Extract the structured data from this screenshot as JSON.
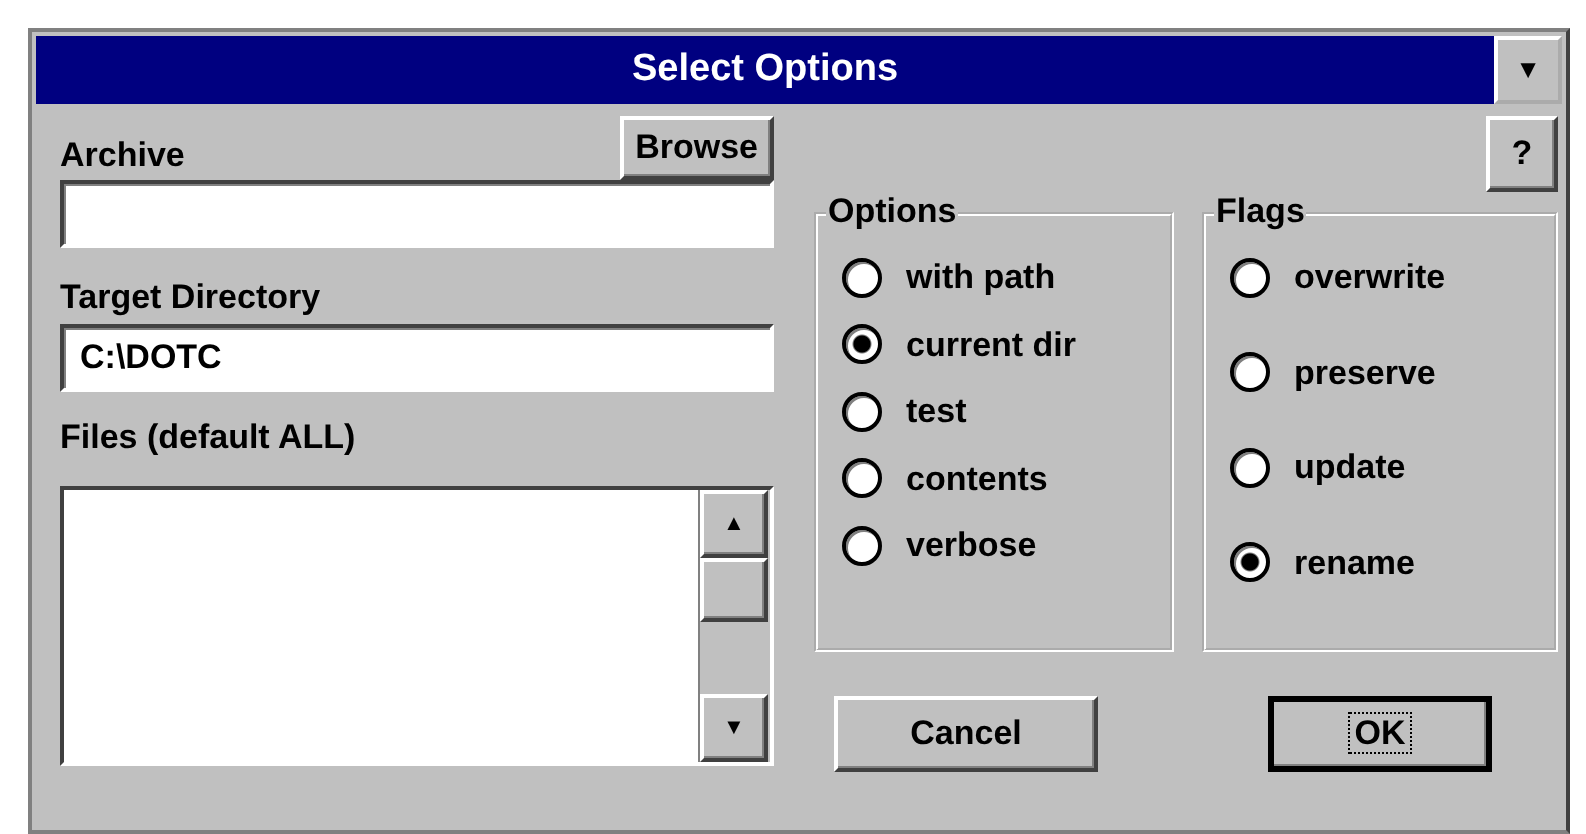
{
  "window": {
    "title": "Select Options",
    "menu_button": "▼"
  },
  "archive": {
    "label": "Archive",
    "browse_button": "Browse"
  },
  "target_directory": {
    "label": "Target Directory",
    "value": "C:\\DOTC"
  },
  "files": {
    "label": "Files (default ALL)",
    "scroll_up": "▲",
    "scroll_down": "▼"
  },
  "help_button": "?",
  "options": {
    "title": "Options",
    "items": [
      {
        "label": "with path",
        "selected": false
      },
      {
        "label": "current dir",
        "selected": true
      },
      {
        "label": "test",
        "selected": false
      },
      {
        "label": "contents",
        "selected": false
      },
      {
        "label": "verbose",
        "selected": false
      }
    ]
  },
  "flags": {
    "title": "Flags",
    "items": [
      {
        "label": "overwrite",
        "selected": false
      },
      {
        "label": "preserve",
        "selected": false
      },
      {
        "label": "update",
        "selected": false
      },
      {
        "label": "rename",
        "selected": true
      }
    ]
  },
  "buttons": [
    {
      "label": "Cancel",
      "default": false
    },
    {
      "label": "OK",
      "default": true
    }
  ]
}
